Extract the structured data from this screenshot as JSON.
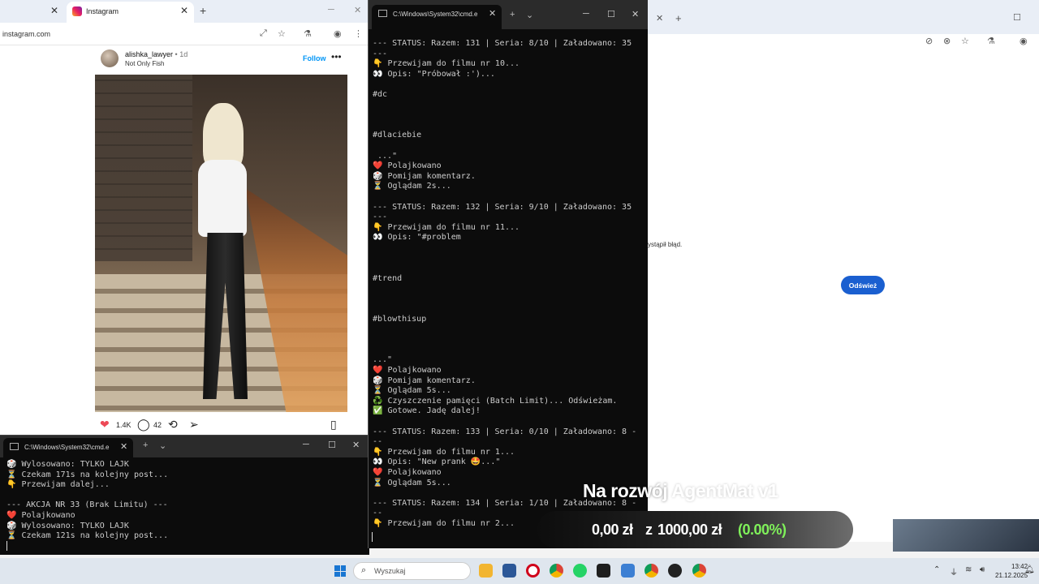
{
  "ig": {
    "tab_title": "Instagram",
    "url": "instagram.com",
    "username": "alishka_lawyer",
    "time": "• 1d",
    "subtitle": "Not Only Fish",
    "follow": "Follow",
    "likes": "1.4K",
    "comments": "42"
  },
  "cmd_small": {
    "title": "C:\\Windows\\System32\\cmd.e",
    "lines": [
      "🎲 Wylosowano: TYLKO LAJK",
      "⏳ Czekam 171s na kolejny post...",
      "👇 Przewijam dalej...",
      "",
      "--- AKCJA NR 33 (Brak Limitu) ---",
      "❤️ Polajkowano",
      "🎲 Wylosowano: TYLKO LAJK",
      "⏳ Czekam 121s na kolejny post..."
    ]
  },
  "cmd_big": {
    "title": "C:\\Windows\\System32\\cmd.e",
    "lines": [
      "--- STATUS: Razem: 131 | Seria: 8/10 | Załadowano: 35",
      "---",
      "👇 Przewijam do filmu nr 10...",
      "👀 Opis: \"Próbował :')...",
      "",
      "#dc",
      "",
      "",
      "",
      "#dlaciebie",
      "",
      " ...\"",
      "❤️ Polajkowano",
      "🎲 Pomijam komentarz.",
      "⏳ Oglądam 2s...",
      "",
      "--- STATUS: Razem: 132 | Seria: 9/10 | Załadowano: 35",
      "---",
      "👇 Przewijam do filmu nr 11...",
      "👀 Opis: \"#problem",
      "",
      "",
      "",
      "#trend",
      "",
      "",
      "",
      "#blowthisup",
      "",
      "",
      "",
      "...\"",
      "❤️ Polajkowano",
      "🎲 Pomijam komentarz.",
      "⏳ Oglądam 5s...",
      "♻️ Czyszczenie pamięci (Batch Limit)... Odświeżam.",
      "✅ Gotowe. Jadę dalej!",
      "",
      "--- STATUS: Razem: 133 | Seria: 0/10 | Załadowano: 8 -",
      "--",
      "👇 Przewijam do filmu nr 1...",
      "👀 Opis: \"New prank 🤩...\"",
      "❤️ Polajkowano",
      "⏳ Oglądam 5s...",
      "",
      "--- STATUS: Razem: 134 | Seria: 1/10 | Załadowano: 8 -",
      "--",
      "👇 Przewijam do filmu nr 2..."
    ]
  },
  "right": {
    "error": "ystąpił błąd.",
    "refresh": "Odśwież"
  },
  "overlay": {
    "title_main": "Na rozwój ",
    "title_dim": "AgentMat v1",
    "current": "0,00 zł",
    "separator": "z",
    "goal": "1000,00 zł",
    "percent": "(0.00%)"
  },
  "taskbar": {
    "search_placeholder": "Wyszukaj",
    "time": "13:42",
    "date": "21.12.2025"
  },
  "colors": {
    "accent": "#1a5fd0",
    "progress_green": "#7ff05a",
    "like_red": "#ed4956",
    "terminal_bg": "#0c0c0c"
  }
}
